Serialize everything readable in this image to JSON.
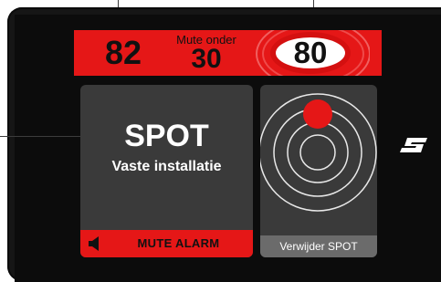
{
  "speed": {
    "current": "82",
    "mute_label": "Mute onder",
    "mute_value": "30",
    "limit": "80"
  },
  "spot": {
    "title": "SPOT",
    "subtitle": "Vaste installatie",
    "mute_button_label": "MUTE ALARM",
    "speaker_icon": "speaker-icon"
  },
  "radar": {
    "icon": "radar-rings-icon",
    "remove_label": "Verwijder SPOT"
  },
  "logo": {
    "icon": "brand-s-logo"
  },
  "colors": {
    "bar_red": "#e51717",
    "panel_gray": "#3a3a3a",
    "radar_dot": "#e51717",
    "remove_bar": "#6b6b6b"
  }
}
